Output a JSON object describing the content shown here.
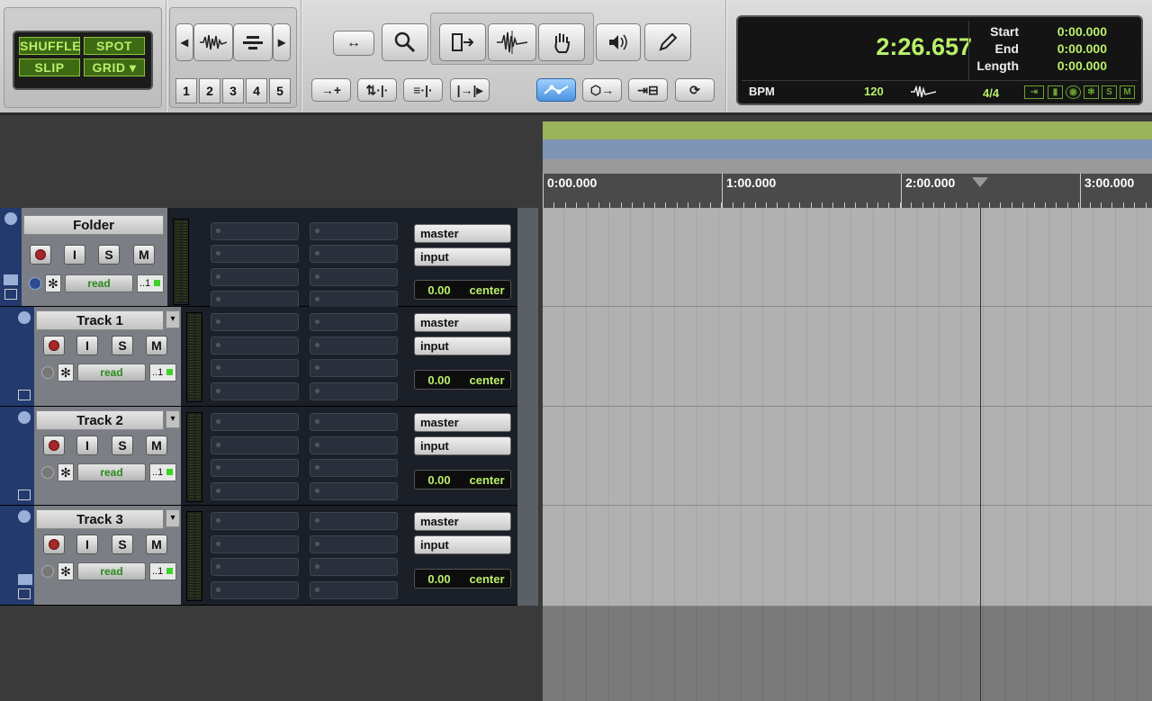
{
  "edit_modes": {
    "shuffle": "SHUFFLE",
    "spot": "SPOT",
    "slip": "SLIP",
    "grid": "GRID"
  },
  "zoom_presets": [
    "1",
    "2",
    "3",
    "4",
    "5"
  ],
  "counter": {
    "main_time": "2:26.657",
    "start_label": "Start",
    "start_value": "0:00.000",
    "end_label": "End",
    "end_value": "0:00.000",
    "length_label": "Length",
    "length_value": "0:00.000",
    "bpm_label": "BPM",
    "bpm_value": "120",
    "meter_value": "4/4",
    "status_icons": [
      "S",
      "M"
    ]
  },
  "ruler": {
    "labels": [
      "0:00.000",
      "1:00.000",
      "2:00.000",
      "3:00.000"
    ]
  },
  "tracks": [
    {
      "name": "Folder",
      "input_btn": "I",
      "solo_btn": "S",
      "mute_btn": "M",
      "automation": "read",
      "vca": "..1",
      "output": "master",
      "input": "input",
      "volume": "0.00",
      "pan": "center"
    },
    {
      "name": "Track 1",
      "input_btn": "I",
      "solo_btn": "S",
      "mute_btn": "M",
      "automation": "read",
      "vca": "..1",
      "output": "master",
      "input": "input",
      "volume": "0.00",
      "pan": "center"
    },
    {
      "name": "Track 2",
      "input_btn": "I",
      "solo_btn": "S",
      "mute_btn": "M",
      "automation": "read",
      "vca": "..1",
      "output": "master",
      "input": "input",
      "volume": "0.00",
      "pan": "center"
    },
    {
      "name": "Track 3",
      "input_btn": "I",
      "solo_btn": "S",
      "mute_btn": "M",
      "automation": "read",
      "vca": "..1",
      "output": "master",
      "input": "input",
      "volume": "0.00",
      "pan": "center"
    }
  ],
  "colors": {
    "accent_green": "#b9ef6a",
    "folder_bar": "#233a6e",
    "ruler_green": "#9bb35a",
    "ruler_blue": "#7d94b5"
  }
}
